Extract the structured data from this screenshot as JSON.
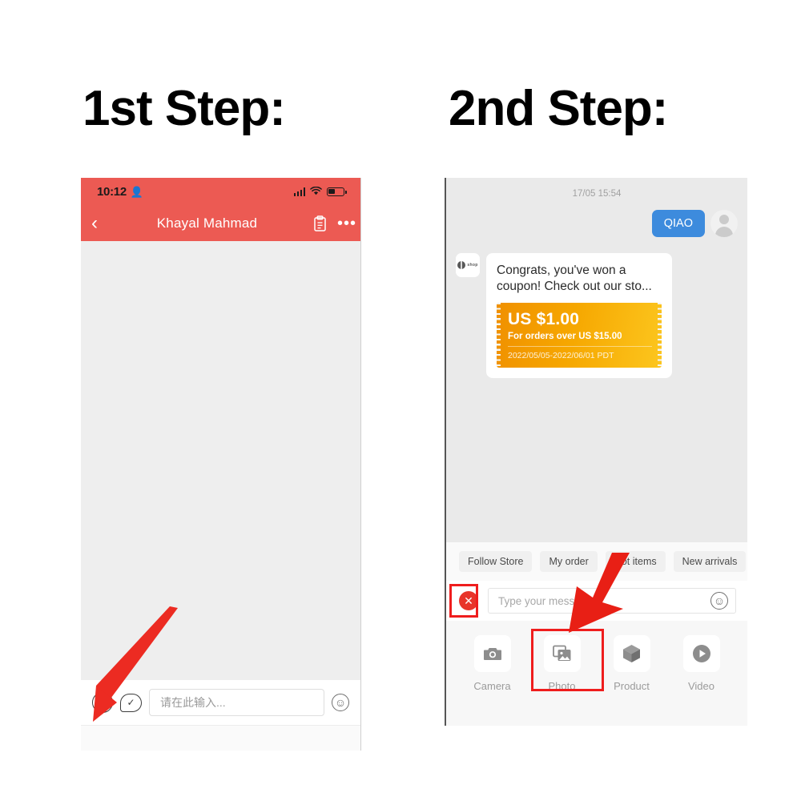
{
  "steps": {
    "step1_title": "1st Step:",
    "step2_title": "2nd Step:"
  },
  "left_phone": {
    "status": {
      "time": "10:12",
      "person_icon": "person-icon",
      "signal_icon": "signal-bars-icon",
      "wifi_icon": "wifi-icon",
      "battery_icon": "battery-icon"
    },
    "nav": {
      "back_icon": "chevron-left-icon",
      "title": "Khayal Mahmad",
      "clipboard_icon": "clipboard-icon",
      "more_icon": "more-dots-icon",
      "more_glyph": "•••"
    },
    "input_bar": {
      "plus_icon": "plus-circle-icon",
      "plus_glyph": "+",
      "quick_reply_icon": "bubble-check-icon",
      "quick_reply_glyph": "✓",
      "placeholder": "请在此输入...",
      "emoji_icon": "smiley-icon",
      "emoji_glyph": "☺"
    },
    "header_color": "#ec5a53"
  },
  "right_phone": {
    "timestamp": "17/05 15:54",
    "outgoing_message": "QIAO",
    "avatar_icon": "user-avatar-icon",
    "shop_avatar_icon": "shop-logo-icon",
    "shop_logo_text": "shop",
    "coupon": {
      "message": "Congrats, you've won a coupon! Check out our sto...",
      "amount": "US $1.00",
      "condition": "For orders over US $15.00",
      "dates": "2022/05/05-2022/06/01 PDT",
      "gradient_from": "#f09000",
      "gradient_to": "#fcc61e"
    },
    "chips": [
      {
        "label": "Follow Store"
      },
      {
        "label": "My order"
      },
      {
        "label": "Hot items"
      },
      {
        "label": "New arrivals"
      }
    ],
    "input_bar": {
      "close_icon": "close-circle-icon",
      "close_glyph": "✕",
      "placeholder": "Type your message...",
      "emoji_icon": "smiley-icon",
      "emoji_glyph": "☺"
    },
    "actions": [
      {
        "label": "Camera",
        "icon": "camera-icon"
      },
      {
        "label": "Photo",
        "icon": "photo-icon"
      },
      {
        "label": "Product",
        "icon": "product-box-icon"
      },
      {
        "label": "Video",
        "icon": "video-play-icon"
      }
    ],
    "bubble_color": "#3d8bdd"
  },
  "annotations": {
    "highlight_color": "#ef1d1d",
    "arrow_left_target": "plus-circle-icon",
    "arrow_right_target": "photo-action-button"
  }
}
